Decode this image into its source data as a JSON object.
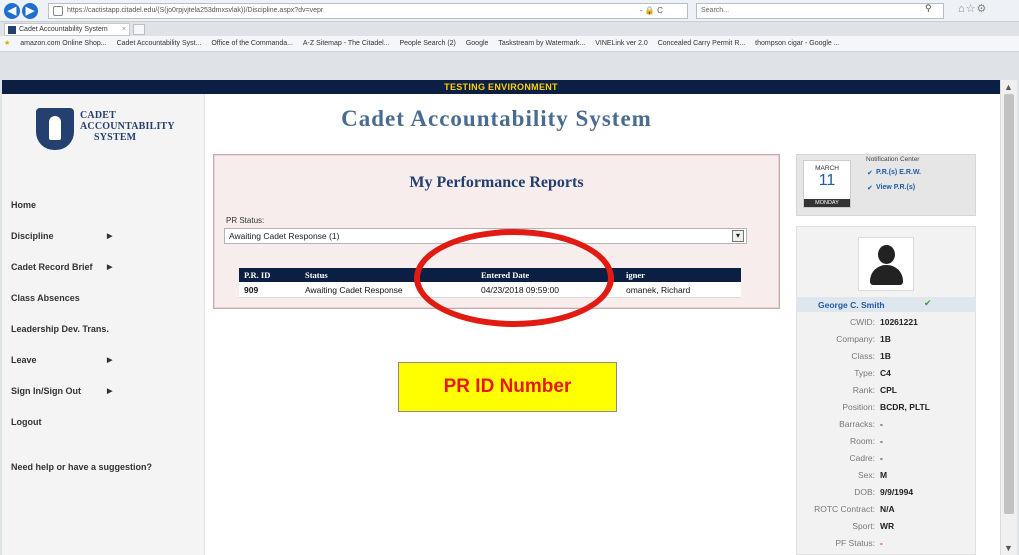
{
  "browser": {
    "url": "https://cactistapp.citadel.edu/(S(jo0rpjvjtela253dmxsvlak))/Discipline.aspx?dv=vepr",
    "tab_title": "Cadet Accountability System",
    "tab_close": "×",
    "search_placeholder": "Search...",
    "url_tools": "- 🔒 C",
    "favorites": [
      "amazon.com Online Shop...",
      "Cadet Accountability Syst...",
      "Office of the Commanda...",
      "A-Z Sitemap - The Citadel...",
      "People Search (2)",
      "Google",
      "Taskstream by Watermark...",
      "VINELink ver 2.0",
      "Concealed Carry Permit R...",
      "thompson cigar - Google ..."
    ]
  },
  "banner": {
    "text": "TESTING ENVIRONMENT"
  },
  "logo": {
    "line1": "CADET",
    "line2": "ACCOUNTABILITY",
    "line3": "SYSTEM"
  },
  "header": {
    "title": "Cadet Accountability System"
  },
  "sidebar": {
    "items": [
      {
        "label": "Home",
        "arrow": ""
      },
      {
        "label": "Discipline",
        "arrow": "▶"
      },
      {
        "label": "Cadet Record Brief",
        "arrow": "▶"
      },
      {
        "label": "Class Absences",
        "arrow": ""
      },
      {
        "label": "Leadership Dev. Trans.",
        "arrow": ""
      },
      {
        "label": "Leave",
        "arrow": "▶"
      },
      {
        "label": "Sign In/Sign Out",
        "arrow": "▶"
      },
      {
        "label": "Logout",
        "arrow": ""
      }
    ],
    "help": "Need help or have a suggestion?"
  },
  "reports": {
    "title": "My Performance Reports",
    "status_label": "PR Status:",
    "status_value": "Awaiting Cadet Response (1)",
    "columns": [
      "P.R. ID",
      "Status",
      "Entered Date",
      "Signer"
    ],
    "columns_visible": [
      "P.R. ID",
      "Status",
      "Entered Date",
      "igner"
    ],
    "rows": [
      {
        "id": "909",
        "status": "Awaiting Cadet Response",
        "date": "04/23/2018 09:59:00",
        "signer": "Tomanek, Richard",
        "signer_visible": "omanek, Richard"
      }
    ]
  },
  "annotation": {
    "callout": "PR ID Number",
    "ellipse_color": "#e11a12",
    "callout_bg": "#ffff00"
  },
  "notification": {
    "month": "MARCH",
    "day": "11",
    "weekday": "MONDAY",
    "title": "Notification Center",
    "links": [
      "P.R.(s) E.R.W.",
      "View P.R.(s)"
    ]
  },
  "profile": {
    "name": "George C. Smith",
    "fields": [
      {
        "k": "CWID:",
        "v": "10261221"
      },
      {
        "k": "Company:",
        "v": "1B"
      },
      {
        "k": "Class:",
        "v": "1B"
      },
      {
        "k": "Type:",
        "v": "C4"
      },
      {
        "k": "Rank:",
        "v": "CPL"
      },
      {
        "k": "Position:",
        "v": "BCDR, PLTL"
      },
      {
        "k": "Barracks:",
        "v": "-"
      },
      {
        "k": "Room:",
        "v": "-"
      },
      {
        "k": "Cadre:",
        "v": "-"
      },
      {
        "k": "Sex:",
        "v": "M"
      },
      {
        "k": "DOB:",
        "v": "9/9/1994"
      },
      {
        "k": "ROTC Contract:",
        "v": "N/A"
      },
      {
        "k": "Sport:",
        "v": "WR"
      },
      {
        "k": "PF Status:",
        "v": "-"
      }
    ]
  },
  "colors": {
    "navy": "#0b1f44",
    "testing_text": "#ffd000",
    "title_blue": "#4a6c90",
    "link_blue": "#1f5aa6"
  }
}
